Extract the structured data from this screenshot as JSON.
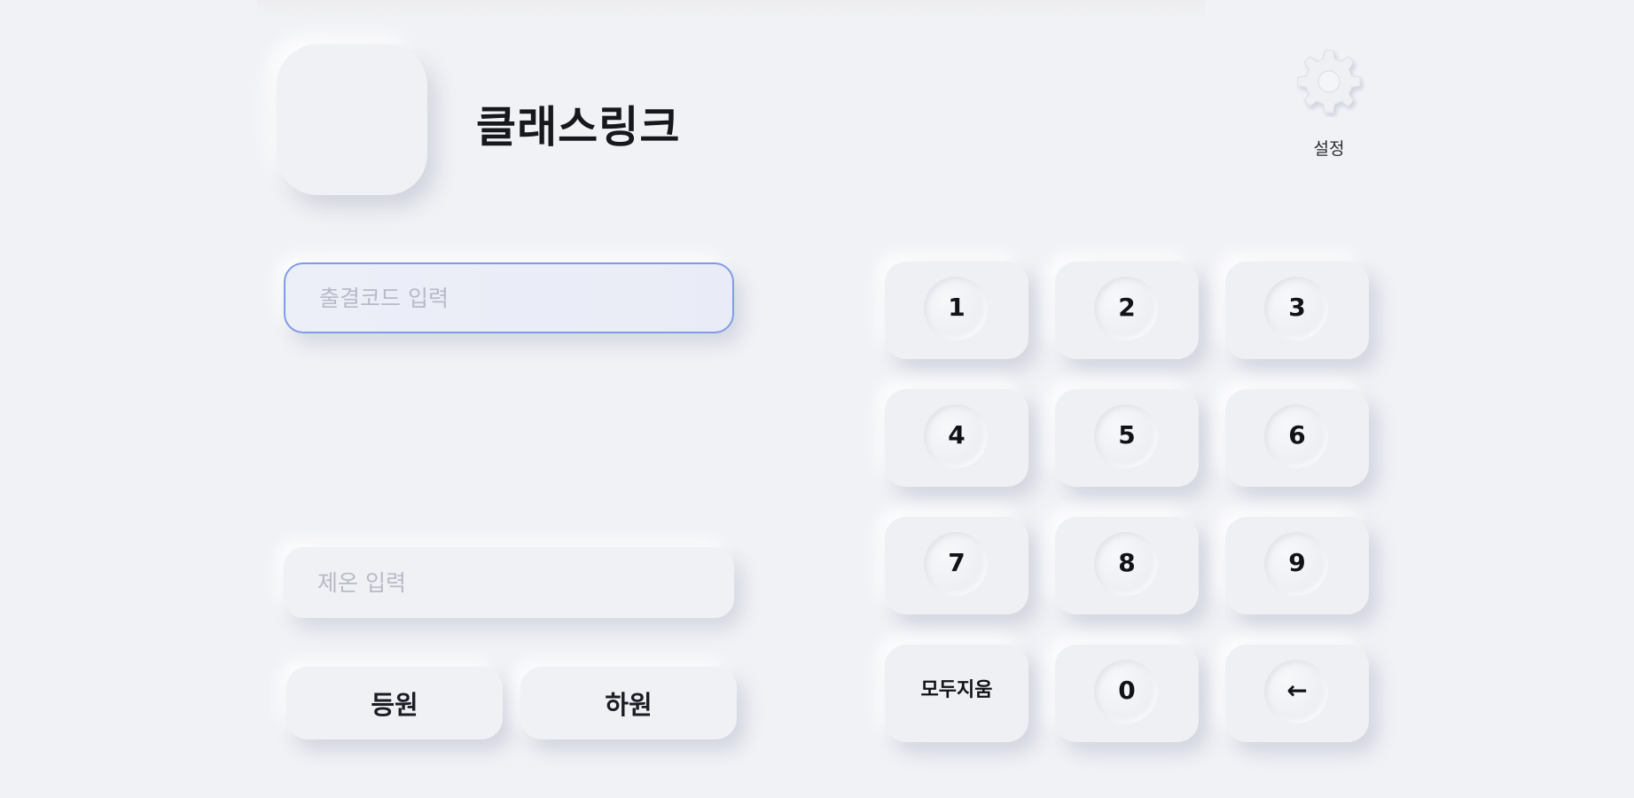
{
  "app": {
    "title": "클래스링크",
    "settings_label": "설정"
  },
  "barcode_input": {
    "placeholder": "출결코드 입력",
    "value": ""
  },
  "name_input": {
    "placeholder": "제온 입력",
    "value": ""
  },
  "buttons": {
    "up": "등원",
    "down": "하원"
  },
  "keypad": {
    "k1": "1",
    "k2": "2",
    "k3": "3",
    "k4": "4",
    "k5": "5",
    "k6": "6",
    "k7": "7",
    "k8": "8",
    "k9": "9",
    "clear_line1": "모두",
    "clear_line2": "지움",
    "k0": "0",
    "backspace": "←"
  },
  "colors": {
    "background": "#f1f2f6",
    "focus_border": "#7f9ce6",
    "text": "#1b1d24",
    "placeholder": "#b7bbc7"
  }
}
